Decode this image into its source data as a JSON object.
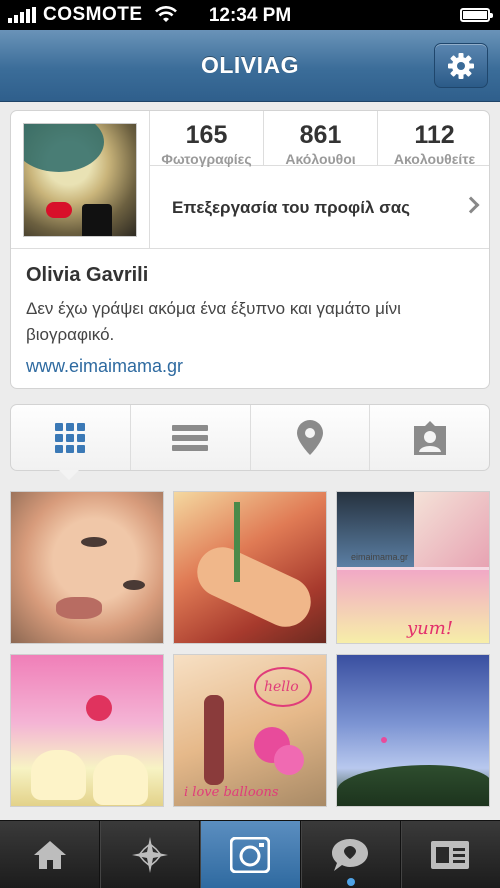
{
  "status_bar": {
    "carrier": "COSMOTE",
    "time": "12:34 PM",
    "signal_bars": 5,
    "battery_level": 1.0
  },
  "navbar": {
    "title": "OLIVIAG",
    "settings_icon": "gear-icon"
  },
  "profile": {
    "stats": [
      {
        "count": "165",
        "label": "Φωτογραφίες"
      },
      {
        "count": "861",
        "label": "Ακόλουθοι"
      },
      {
        "count": "112",
        "label": "Ακολουθείτε"
      }
    ],
    "edit_profile_label": "Επεξεργασία του προφίλ σας",
    "full_name": "Olivia Gavrili",
    "bio": "Δεν έχω γράψει ακόμα ένα έξυπνο και γαμάτο μίνι βιογραφικό.",
    "website": "www.eimaimama.gr"
  },
  "view_tabs": [
    {
      "icon": "grid-icon",
      "active": true
    },
    {
      "icon": "list-icon",
      "active": false
    },
    {
      "icon": "location-pin-icon",
      "active": false
    },
    {
      "icon": "tagged-photos-icon",
      "active": false
    }
  ],
  "photos": [
    {
      "subject": "child-face",
      "caption": ""
    },
    {
      "subject": "baby-lying",
      "caption": ""
    },
    {
      "subject": "collage-cupcakes",
      "caption": "yum!",
      "watermark": "eimaimama.gr"
    },
    {
      "subject": "pony-cupcakes",
      "caption": ""
    },
    {
      "subject": "girl-balloons",
      "caption": "i love balloons",
      "bubble": "hello"
    },
    {
      "subject": "sky-balloon",
      "caption": ""
    }
  ],
  "toolbar": [
    {
      "icon": "home-icon"
    },
    {
      "icon": "explore-icon"
    },
    {
      "icon": "camera-icon",
      "active": true
    },
    {
      "icon": "news-icon"
    },
    {
      "icon": "profile-icon"
    }
  ],
  "colors": {
    "nav_blue": "#3b6d99",
    "link_blue": "#2e6aa0",
    "active_tab_icon": "#3b79b6"
  }
}
